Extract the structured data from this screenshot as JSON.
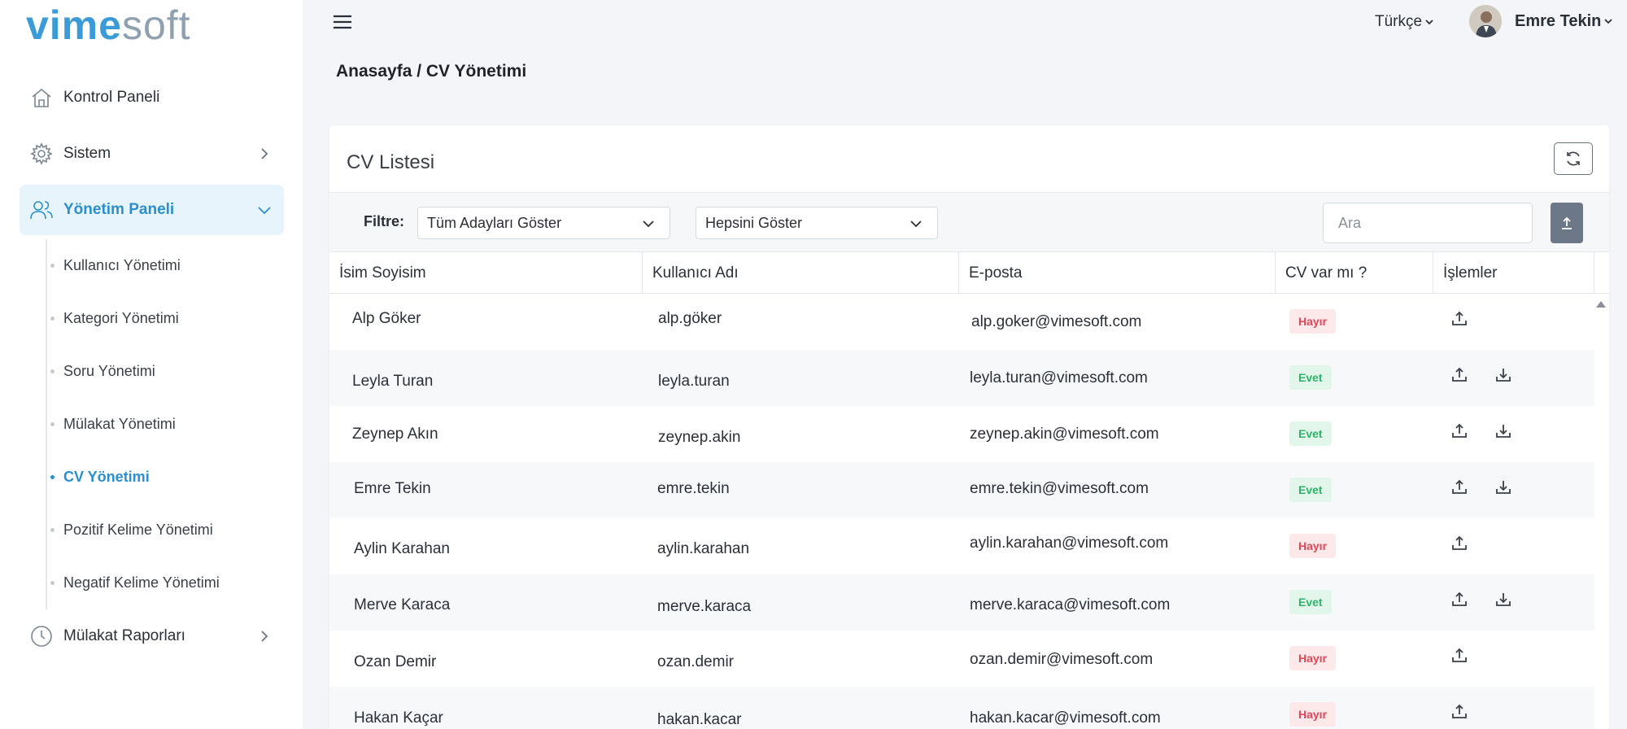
{
  "logo": {
    "part1": "vime",
    "part2": "soft"
  },
  "sidebar": {
    "items": [
      {
        "label": "Kontrol Paneli",
        "icon": "home-icon"
      },
      {
        "label": "Sistem",
        "icon": "gear-icon"
      },
      {
        "label": "Yönetim Paneli",
        "icon": "users-icon"
      },
      {
        "label": "Mülakat Raporları",
        "icon": "clock-icon"
      }
    ],
    "subitems": [
      {
        "label": "Kullanıcı Yönetimi"
      },
      {
        "label": "Kategori Yönetimi"
      },
      {
        "label": "Soru Yönetimi"
      },
      {
        "label": "Mülakat Yönetimi"
      },
      {
        "label": "CV Yönetimi"
      },
      {
        "label": "Pozitif Kelime Yönetimi"
      },
      {
        "label": "Negatif Kelime Yönetimi"
      }
    ]
  },
  "header": {
    "language": "Türkçe",
    "user_name": "Emre Tekin"
  },
  "breadcrumb": "Anasayfa / CV Yönetimi",
  "card": {
    "title": "CV Listesi",
    "filter_label": "Filtre:",
    "filter1": "Tüm Adayları Göster",
    "filter2": "Hepsini Göster",
    "search_placeholder": "Ara"
  },
  "table": {
    "columns": [
      "İsim Soyisim",
      "Kullanıcı Adı",
      "E-posta",
      "CV var mı ?",
      "İşlemler"
    ],
    "rows": [
      {
        "name": "Alp Göker",
        "username": "alp.göker",
        "email": "alp.goker@vimesoft.com",
        "cv": "Hayır"
      },
      {
        "name": "Leyla Turan",
        "username": "leyla.turan",
        "email": "leyla.turan@vimesoft.com",
        "cv": "Evet"
      },
      {
        "name": "Zeynep Akın",
        "username": "zeynep.akin",
        "email": "zeynep.akin@vimesoft.com",
        "cv": "Evet"
      },
      {
        "name": "Emre Tekin",
        "username": "emre.tekin",
        "email": "emre.tekin@vimesoft.com",
        "cv": "Evet"
      },
      {
        "name": "Aylin Karahan",
        "username": "aylin.karahan",
        "email": "aylin.karahan@vimesoft.com",
        "cv": "Hayır"
      },
      {
        "name": "Merve Karaca",
        "username": "merve.karaca",
        "email": "merve.karaca@vimesoft.com",
        "cv": "Evet"
      },
      {
        "name": "Ozan Demir",
        "username": "ozan.demir",
        "email": "ozan.demir@vimesoft.com",
        "cv": "Hayır"
      },
      {
        "name": "Hakan Kaçar",
        "username": "hakan.kacar",
        "email": "hakan.kacar@vimesoft.com",
        "cv": "Hayır"
      }
    ]
  },
  "colors": {
    "accent": "#2a8fd0",
    "yes": "#2fb36a",
    "no": "#e0485a"
  }
}
